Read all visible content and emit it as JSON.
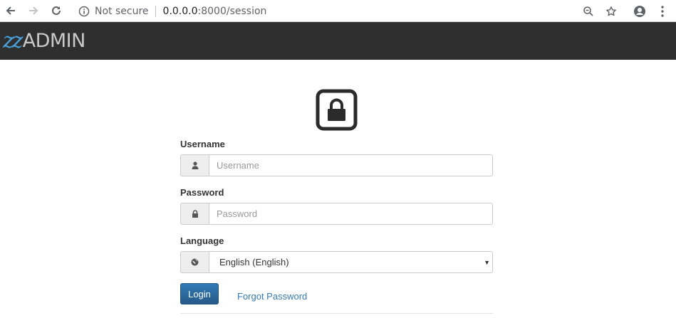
{
  "browser": {
    "security_label": "Not secure",
    "url_host": "0.0.0.0",
    "url_path": ":8000/session"
  },
  "app": {
    "logo_mark": "zz",
    "logo_text": "ADMIN"
  },
  "login": {
    "username_label": "Username",
    "username_placeholder": "Username",
    "password_label": "Password",
    "password_placeholder": "Password",
    "language_label": "Language",
    "language_value": "English (English)",
    "login_button": "Login",
    "forgot_link": "Forgot Password"
  },
  "icons": {
    "lock": "lock-icon",
    "user": "user-icon",
    "password": "lock-icon",
    "language": "globe-icon"
  },
  "colors": {
    "header_bg": "#2f2f2f",
    "logo_accent": "#4aa3df",
    "primary": "#337ab7",
    "link": "#337ab7"
  }
}
